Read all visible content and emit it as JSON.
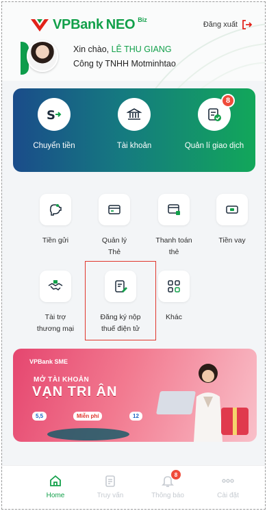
{
  "header": {
    "brand": "VPBank",
    "brand_suffix": "NEO",
    "brand_badge": "Biz",
    "logout_label": "Đăng xuất",
    "greeting_prefix": "Xin chào, ",
    "user_name": "LÊ THU GIANG",
    "company": "Công ty TNHH Motminhtao"
  },
  "quick_actions": [
    {
      "label": "Chuyển tiền",
      "icon": "transfer-icon"
    },
    {
      "label": "Tài khoản",
      "icon": "bank-icon"
    },
    {
      "label": "Quản lí giao dịch",
      "icon": "transaction-manage-icon",
      "badge": "8"
    }
  ],
  "services": [
    {
      "label": "Tiền gửi",
      "icon": "piggy-bank-icon"
    },
    {
      "label": "Quản lý\nThẻ",
      "icon": "card-icon"
    },
    {
      "label": "Thanh toán\nthẻ",
      "icon": "card-payment-icon"
    },
    {
      "label": "Tiền vay",
      "icon": "loan-icon"
    },
    {
      "label": "Tài trợ\nthương mại",
      "icon": "trade-finance-icon"
    },
    {
      "label": "Đăng ký nộp\nthuế điện tử",
      "icon": "tax-register-icon"
    },
    {
      "label": "Khác",
      "icon": "more-grid-icon"
    }
  ],
  "promo": {
    "brand": "VPBank SME",
    "line1": "MỞ TÀI KHOẢN",
    "line2": "VẠN TRI ÂN",
    "tag1": "5,5",
    "tag2": "Miễn phí",
    "tag3": "12"
  },
  "nav": [
    {
      "label": "Home",
      "icon": "home-icon",
      "active": true
    },
    {
      "label": "Truy vấn",
      "icon": "query-icon"
    },
    {
      "label": "Thông báo",
      "icon": "bell-icon",
      "badge": "8"
    },
    {
      "label": "Cài đặt",
      "icon": "settings-dots-icon"
    }
  ],
  "colors": {
    "brand_green": "#12a04a",
    "badge_red": "#ef4b3a",
    "highlight_red": "#e0352b"
  }
}
